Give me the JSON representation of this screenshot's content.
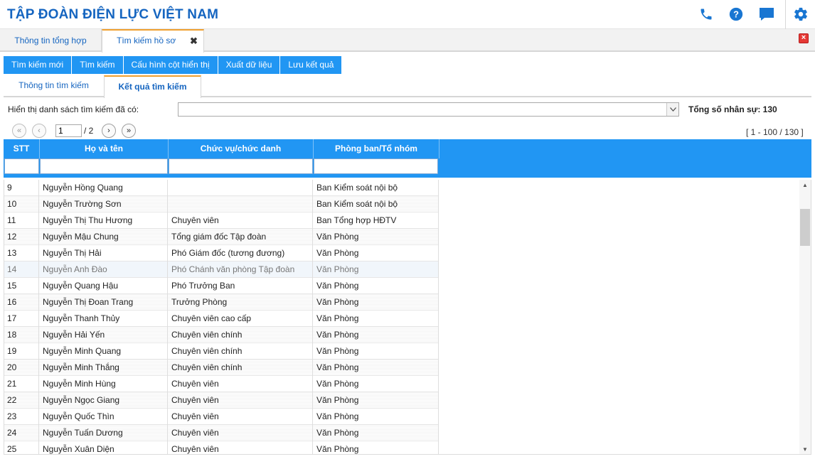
{
  "app": {
    "title": "TẬP ĐOÀN ĐIỆN LỰC VIỆT NAM"
  },
  "header_icons": [
    "phone-icon",
    "help-icon",
    "chat-icon",
    "settings-icon"
  ],
  "colors": {
    "brand": "#1565c0",
    "accent": "#2196f3",
    "active_tab_border": "#f0a030",
    "close": "#e53935"
  },
  "top_tabs": [
    {
      "label": "Thông tin tổng hợp"
    },
    {
      "label": "Tìm kiếm hồ sơ",
      "active": true
    }
  ],
  "toolbar": [
    {
      "label": "Tìm kiếm mới"
    },
    {
      "label": "Tìm kiếm"
    },
    {
      "label": "Cấu hình cột hiển thị"
    },
    {
      "label": "Xuất dữ liệu"
    },
    {
      "label": "Lưu kết quả"
    }
  ],
  "sub_tabs": [
    {
      "label": "Thông tin tìm kiếm"
    },
    {
      "label": "Kết quả tìm kiếm",
      "active": true
    }
  ],
  "filter": {
    "label": "Hiển thị danh sách tìm kiếm đã có:",
    "selected": "",
    "total": "Tổng số nhân sự: 130"
  },
  "pager": {
    "page": "1",
    "total_pages": "/ 2",
    "range": "[ 1 - 100 / 130 ]"
  },
  "grid": {
    "columns": [
      "STT",
      "Họ và tên",
      "Chức vụ/chức danh",
      "Phòng ban/Tổ nhóm"
    ],
    "rows": [
      [
        "9",
        "Nguyễn Hồng Quang",
        "",
        "Ban Kiểm soát nội bộ"
      ],
      [
        "10",
        "Nguyễn Trường Sơn",
        "",
        "Ban Kiểm soát nội bộ"
      ],
      [
        "11",
        "Nguyễn Thị Thu Hương",
        "Chuyên viên",
        "Ban Tổng hợp HĐTV"
      ],
      [
        "12",
        "Nguyễn Mậu Chung",
        "Tổng giám đốc Tập đoàn",
        "Văn Phòng"
      ],
      [
        "13",
        "Nguyễn Thị Hải",
        "Phó Giám đốc (tương đương)",
        "Văn Phòng"
      ],
      [
        "14",
        "Nguyễn Anh Đào",
        "Phó Chánh văn phòng Tập đoàn",
        "Văn Phòng"
      ],
      [
        "15",
        "Nguyễn Quang Hậu",
        "Phó Trưởng Ban",
        "Văn Phòng"
      ],
      [
        "16",
        "Nguyễn Thị Đoan Trang",
        "Trưởng Phòng",
        "Văn Phòng"
      ],
      [
        "17",
        "Nguyễn Thanh Thủy",
        "Chuyên viên cao cấp",
        "Văn Phòng"
      ],
      [
        "18",
        "Nguyễn Hải Yến",
        "Chuyên viên chính",
        "Văn Phòng"
      ],
      [
        "19",
        "Nguyễn Minh Quang",
        "Chuyên viên chính",
        "Văn Phòng"
      ],
      [
        "20",
        "Nguyễn Minh Thắng",
        "Chuyên viên chính",
        "Văn Phòng"
      ],
      [
        "21",
        "Nguyễn Minh Hùng",
        "Chuyên viên",
        "Văn Phòng"
      ],
      [
        "22",
        "Nguyễn Ngọc Giang",
        "Chuyên viên",
        "Văn Phòng"
      ],
      [
        "23",
        "Nguyễn Quốc Thìn",
        "Chuyên viên",
        "Văn Phòng"
      ],
      [
        "24",
        "Nguyễn Tuấn Dương",
        "Chuyên viên",
        "Văn Phòng"
      ],
      [
        "25",
        "Nguyễn Xuân Diện",
        "Chuyên viên",
        "Văn Phòng"
      ]
    ],
    "highlighted_row": "14"
  }
}
